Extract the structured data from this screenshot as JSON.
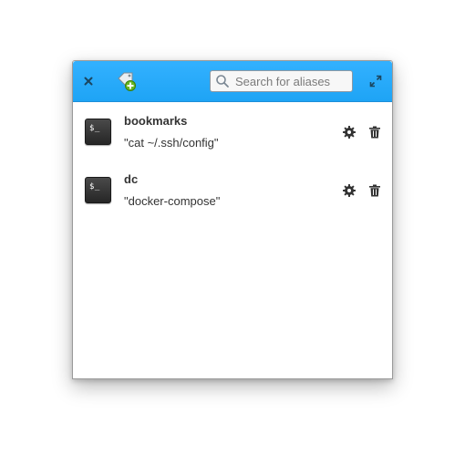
{
  "header": {
    "search": {
      "placeholder": "Search for aliases",
      "value": ""
    },
    "accent_color": "#28abf8"
  },
  "aliases": [
    {
      "name": "bookmarks",
      "command": "\"cat ~/.ssh/config\"",
      "icon_text": "$_"
    },
    {
      "name": "dc",
      "command": "\"docker-compose\"",
      "icon_text": "$_"
    }
  ],
  "icons": {
    "close": "close-icon",
    "add": "add-alias-icon",
    "search": "search-icon",
    "maximize": "maximize-icon",
    "settings": "gear-icon",
    "delete": "trash-icon",
    "alias": "terminal-icon"
  }
}
